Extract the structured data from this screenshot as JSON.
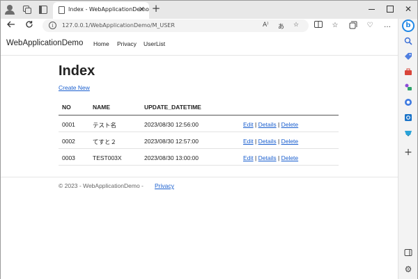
{
  "browser": {
    "tab_title": "Index - WebApplicationDemo",
    "url": "127.0.0.1/WebApplicationDemo/M_USER",
    "new_tab_symbol": "+",
    "close_symbol": "✕"
  },
  "site": {
    "brand": "WebApplicationDemo",
    "nav": [
      "Home",
      "Privacy",
      "UserList"
    ]
  },
  "page": {
    "title": "Index",
    "create_link": "Create New",
    "columns": [
      "NO",
      "NAME",
      "UPDATE_DATETIME"
    ],
    "rows": [
      {
        "no": "0001",
        "name": "テスト名",
        "updated": "2023/08/30 12:56:00"
      },
      {
        "no": "0002",
        "name": "てすと２",
        "updated": "2023/08/30 12:57:00"
      },
      {
        "no": "0003",
        "name": "TEST003X",
        "updated": "2023/08/30 13:00:00"
      }
    ],
    "actions": {
      "edit": "Edit",
      "details": "Details",
      "delete": "Delete",
      "separator": "|"
    }
  },
  "footer": {
    "copyright": "© 2023 - WebApplicationDemo - ",
    "privacy": "Privacy"
  },
  "icons": {
    "accent": "#1a5fcf",
    "bing": "#1f87e5"
  }
}
